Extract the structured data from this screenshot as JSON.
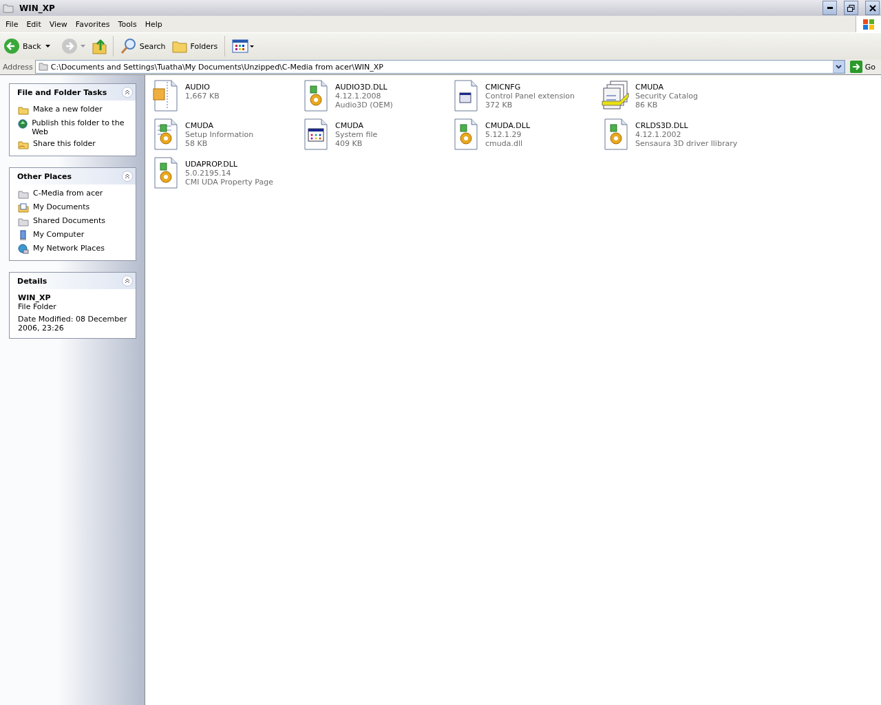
{
  "window": {
    "title": "WIN_XP"
  },
  "menu": [
    "File",
    "Edit",
    "View",
    "Favorites",
    "Tools",
    "Help"
  ],
  "toolbar": {
    "back": "Back",
    "search": "Search",
    "folders": "Folders"
  },
  "address": {
    "label": "Address",
    "value": "C:\\Documents and Settings\\Tuatha\\My Documents\\Unzipped\\C-Media from acer\\WIN_XP",
    "go": "Go"
  },
  "panels": [
    {
      "title": "File and Folder Tasks",
      "expanded": true,
      "items": [
        {
          "kind": "new-folder",
          "label": "Make a new folder"
        },
        {
          "kind": "globe",
          "label": "Publish this folder to the Web"
        },
        {
          "kind": "share",
          "label": "Share this folder"
        }
      ]
    },
    {
      "title": "Other Places",
      "expanded": true,
      "items": [
        {
          "kind": "folder",
          "label": "C-Media from acer"
        },
        {
          "kind": "documents",
          "label": "My Documents"
        },
        {
          "kind": "folder",
          "label": "Shared Documents"
        },
        {
          "kind": "computer",
          "label": "My Computer"
        },
        {
          "kind": "network",
          "label": "My Network Places"
        }
      ]
    }
  ],
  "details": {
    "title": "Details",
    "expanded": true,
    "name": "WIN_XP",
    "type": "File Folder",
    "modified": "Date Modified: 08 December 2006, 23:26"
  },
  "files": [
    {
      "kind": "archive",
      "name": "AUDIO",
      "lines": [
        "1,667 KB"
      ]
    },
    {
      "kind": "dll",
      "name": "AUDIO3D.DLL",
      "lines": [
        "4.12.1.2008",
        "Audio3D (OEM)"
      ]
    },
    {
      "kind": "cpl",
      "name": "CMICNFG",
      "lines": [
        "Control Panel extension",
        "372 KB"
      ]
    },
    {
      "kind": "cat",
      "name": "CMUDA",
      "lines": [
        "Security Catalog",
        "86 KB"
      ]
    },
    {
      "kind": "inf",
      "name": "CMUDA",
      "lines": [
        "Setup Information",
        "58 KB"
      ]
    },
    {
      "kind": "sys",
      "name": "CMUDA",
      "lines": [
        "System file",
        "409 KB"
      ]
    },
    {
      "kind": "dll",
      "name": "CMUDA.DLL",
      "lines": [
        "5.12.1.29",
        "cmuda.dll"
      ]
    },
    {
      "kind": "dll",
      "name": "CRLDS3D.DLL",
      "lines": [
        "4.12.1.2002",
        "Sensaura 3D driver llibrary"
      ]
    },
    {
      "kind": "dll",
      "name": "UDAPROP.DLL",
      "lines": [
        "5.0.2195.14",
        "CMI UDA Property Page"
      ]
    }
  ]
}
